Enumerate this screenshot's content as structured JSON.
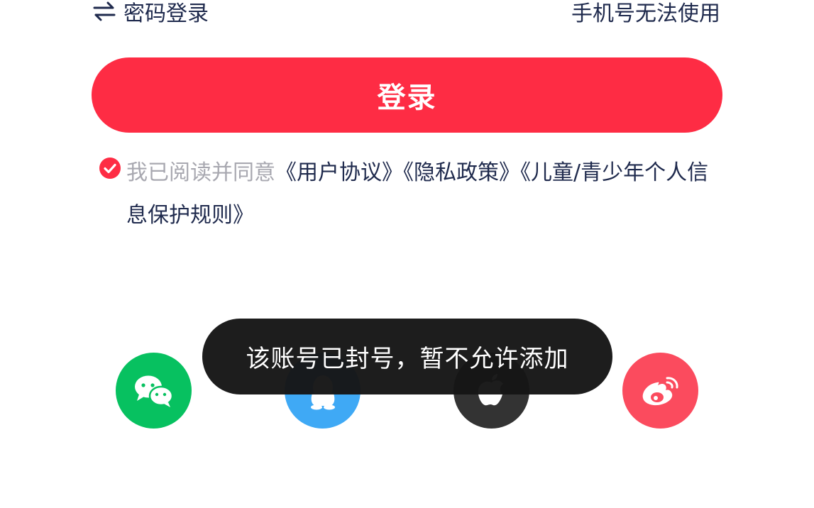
{
  "top": {
    "switch_label": "密码登录",
    "switch_icon": "swap-arrows-icon",
    "phone_unusable_label": "手机号无法使用"
  },
  "login_button": {
    "label": "登录",
    "color": "#fe2c44"
  },
  "agreement": {
    "checked": true,
    "prefix": "我已阅读并同意",
    "user_agreement": "《用户协议》",
    "privacy_policy": "《隐私政策》",
    "child_policy": "《儿童/青少年个人信息保护规则》"
  },
  "social": [
    {
      "name": "wechat",
      "icon": "wechat-icon",
      "color": "#07c160"
    },
    {
      "name": "qq",
      "icon": "qq-icon",
      "color": "#3fa9f5"
    },
    {
      "name": "apple",
      "icon": "apple-icon",
      "color": "#333333"
    },
    {
      "name": "weibo",
      "icon": "weibo-icon",
      "color": "#fb4b5e"
    }
  ],
  "toast": {
    "message": "该账号已封号，暂不允许添加"
  }
}
